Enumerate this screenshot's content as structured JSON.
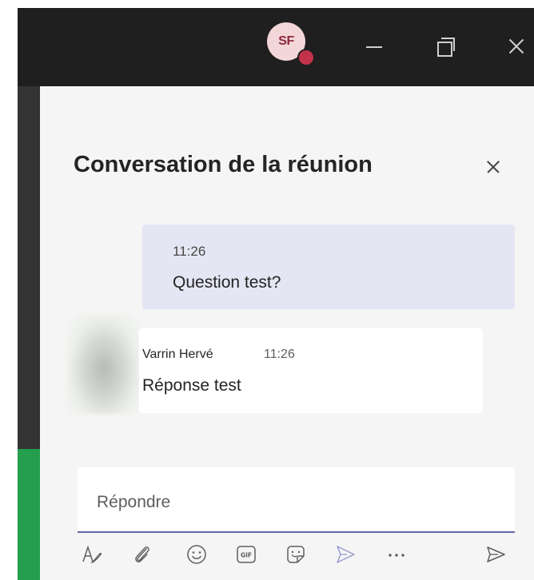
{
  "titlebar": {
    "avatar_initials": "SF",
    "presence_color": "#c4314b"
  },
  "panel": {
    "title": "Conversation de la réunion"
  },
  "messages": [
    {
      "time": "11:26",
      "text": "Question test?"
    },
    {
      "sender": "Varrin Hervé",
      "time": "11:26",
      "text": "Réponse test"
    }
  ],
  "compose": {
    "placeholder": "Répondre"
  },
  "toolbar": {
    "icons": [
      "format-icon",
      "attach-icon",
      "emoji-icon",
      "gif-icon",
      "sticker-icon",
      "praise-icon",
      "more-icon",
      "send-icon"
    ]
  },
  "colors": {
    "accent": "#6264a7",
    "titlebar": "#1f1f1f",
    "panel": "#f5f5f5",
    "my_bubble": "#e5e6f4",
    "rail_accent": "#239f4e"
  }
}
